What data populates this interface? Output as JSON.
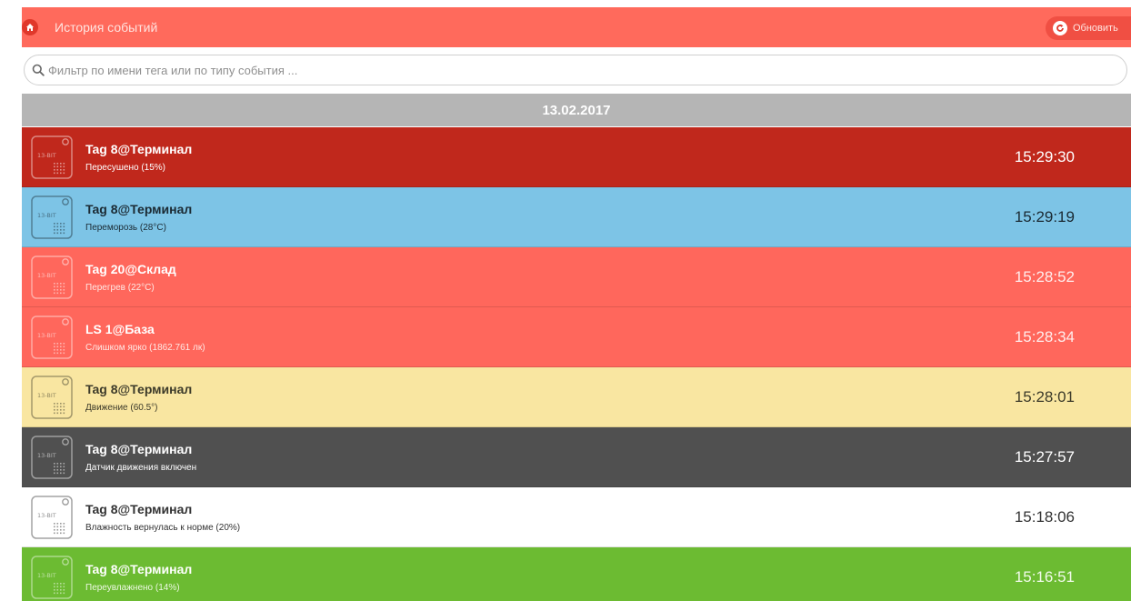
{
  "header": {
    "title": "История событий",
    "refresh_label": "Обновить"
  },
  "search": {
    "placeholder": "Фильтр по имени тега или по типу события ..."
  },
  "date_header": "13.02.2017",
  "icons": {
    "home": "home-icon",
    "refresh": "refresh-icon",
    "search": "search-icon",
    "tag": "tag-device-icon",
    "tag_label": "13-BIT"
  },
  "colors": {
    "header": "#ff6a5c",
    "dark_red": "#c0281c",
    "blue": "#7dc4e6",
    "red": "#ff675c",
    "yellow": "#f9e6a1",
    "dark_gray": "#505050",
    "white": "#ffffff",
    "green": "#6cbb32",
    "date_bar": "#b5b5b5"
  },
  "events": [
    {
      "name": "Tag 8@Терминал",
      "description": "Пересушено (15%)",
      "time": "15:29:30",
      "color": "c-darkred"
    },
    {
      "name": "Tag 8@Терминал",
      "description": "Переморозь (28°C)",
      "time": "15:29:19",
      "color": "c-blue"
    },
    {
      "name": "Tag 20@Склад",
      "description": "Перегрев (22°C)",
      "time": "15:28:52",
      "color": "c-red"
    },
    {
      "name": "LS 1@База",
      "description": "Слишком ярко (1862.761 лк)",
      "time": "15:28:34",
      "color": "c-red"
    },
    {
      "name": "Tag 8@Терминал",
      "description": "Движение (60.5°)",
      "time": "15:28:01",
      "color": "c-yellow"
    },
    {
      "name": "Tag 8@Терминал",
      "description": "Датчик движения включен",
      "time": "15:27:57",
      "color": "c-darkgray"
    },
    {
      "name": "Tag 8@Терминал",
      "description": "Влажность вернулась к норме (20%)",
      "time": "15:18:06",
      "color": "c-white"
    },
    {
      "name": "Tag 8@Терминал",
      "description": "Переувлажнено (14%)",
      "time": "15:16:51",
      "color": "c-green"
    }
  ]
}
